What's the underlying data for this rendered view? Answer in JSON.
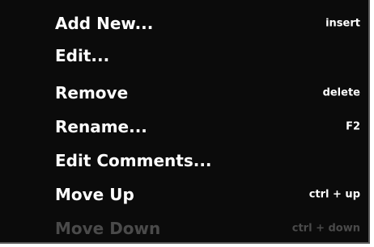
{
  "menu": {
    "items": [
      {
        "label": "Add New...",
        "shortcut": "insert",
        "enabled": true
      },
      {
        "label": "Edit...",
        "shortcut": "",
        "enabled": true
      },
      {
        "label": "Remove",
        "shortcut": "delete",
        "enabled": true
      },
      {
        "label": "Rename...",
        "shortcut": "F2",
        "enabled": true
      },
      {
        "label": "Edit Comments...",
        "shortcut": "",
        "enabled": true
      },
      {
        "label": "Move Up",
        "shortcut": "ctrl + up",
        "enabled": true
      },
      {
        "label": "Move Down",
        "shortcut": "ctrl + down",
        "enabled": false
      }
    ]
  },
  "colors": {
    "background": "#0b0b0b",
    "text": "#ffffff",
    "disabled_text": "#4a4a4a",
    "border": "#5a5a5a"
  }
}
